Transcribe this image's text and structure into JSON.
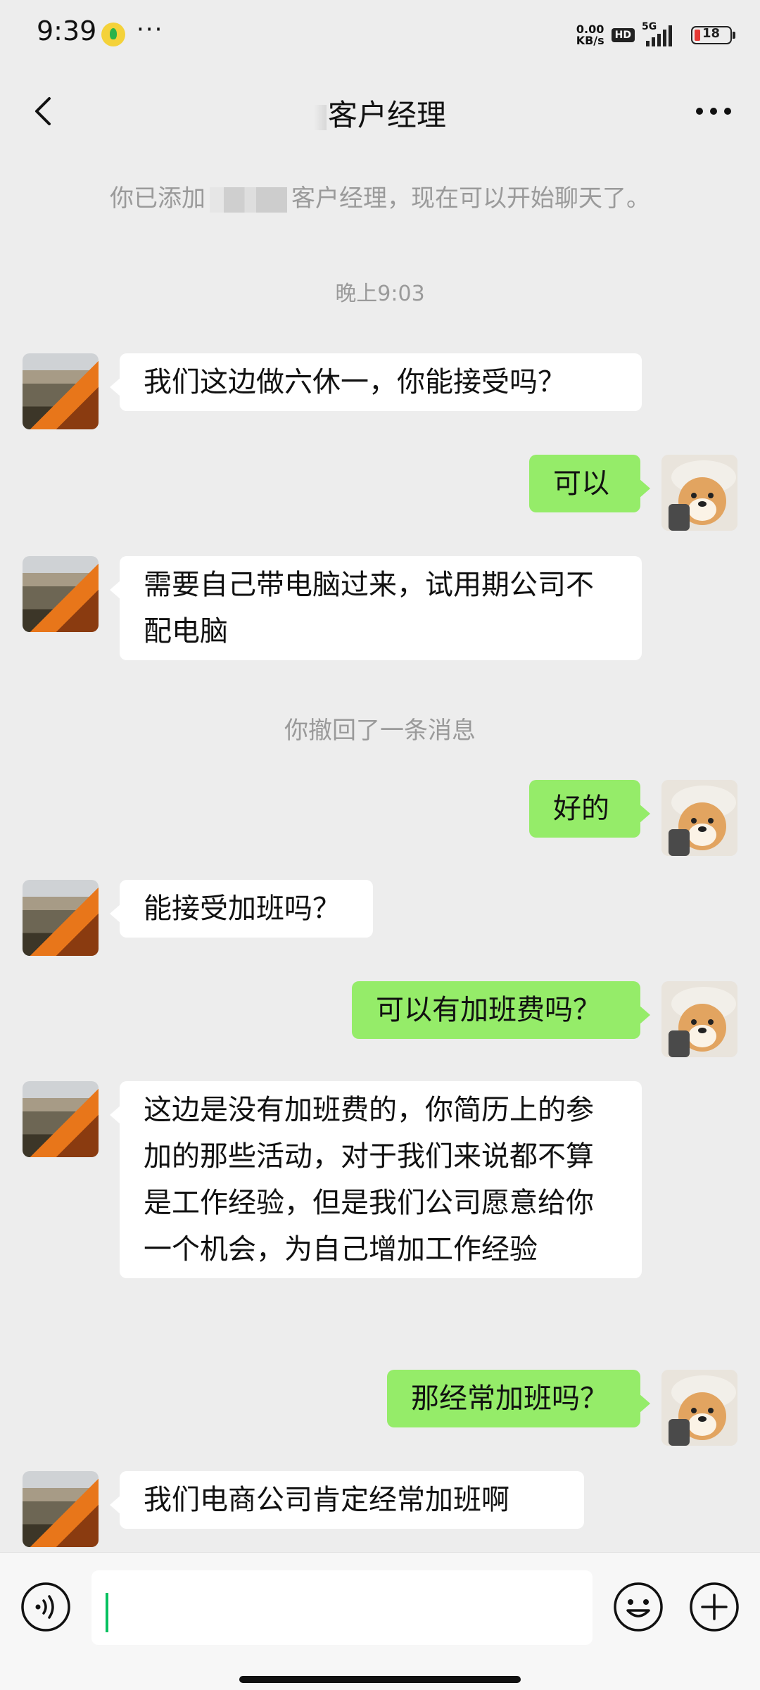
{
  "status_bar": {
    "time": "9:39",
    "more": "···",
    "net_speed_value": "0.00",
    "net_speed_unit": "KB/s",
    "hd": "HD",
    "network": "5G",
    "battery": "18",
    "battery_color": "#e53935"
  },
  "header": {
    "title": "客户经理",
    "back_icon": "chevron-left-icon",
    "more_icon": "more-dots-icon"
  },
  "chat": {
    "added_notice_prefix": "你已添加",
    "added_notice_suffix": "客户经理，现在可以开始聊天了。",
    "time_label": "晚上9:03",
    "recall_notice": "你撤回了一条消息",
    "messages": [
      {
        "from": "contact",
        "text": "我们这边做六休一，你能接受吗？"
      },
      {
        "from": "me",
        "text": "可以"
      },
      {
        "from": "contact",
        "text": "需要自己带电脑过来，试用期公司不配电脑"
      },
      {
        "from": "me",
        "text": "好的"
      },
      {
        "from": "contact",
        "text": "能接受加班吗？"
      },
      {
        "from": "me",
        "text": "可以有加班费吗？"
      },
      {
        "from": "contact",
        "text": "这边是没有加班费的，你简历上的参加的那些活动，对于我们来说都不算是工作经验，但是我们公司愿意给你一个机会，为自己增加工作经验"
      },
      {
        "from": "me",
        "text": "那经常加班吗？"
      },
      {
        "from": "contact",
        "text": "我们电商公司肯定经常加班啊"
      }
    ],
    "outgoing_bubble_color": "#95ec69",
    "incoming_bubble_color": "#ffffff"
  },
  "input_bar": {
    "value": "",
    "voice_icon": "voice-icon",
    "emoji_icon": "emoji-icon",
    "plus_icon": "plus-icon",
    "caret_color": "#07c160"
  }
}
